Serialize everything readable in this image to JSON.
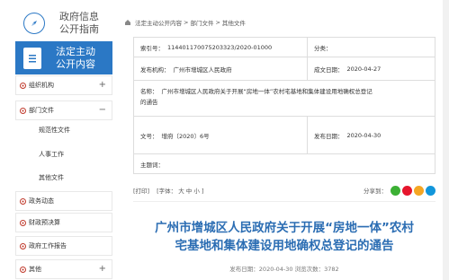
{
  "sidebar": {
    "guide_label_1": "政府信息",
    "guide_label_2": "公开指南",
    "active_label_1": "法定主动",
    "active_label_2": "公开内容",
    "items": [
      {
        "label": "组织机构",
        "toggle": "+"
      },
      {
        "label": "部门文件",
        "toggle": "−"
      },
      {
        "label": "规范性文件"
      },
      {
        "label": "人事工作"
      },
      {
        "label": "其他文件"
      },
      {
        "label": "政务动态"
      },
      {
        "label": "财政预决算"
      },
      {
        "label": "政府工作报告"
      },
      {
        "label": "其他",
        "toggle": "+"
      }
    ]
  },
  "breadcrumb": [
    "法定主动公开内容",
    "部门文件",
    "其他文件"
  ],
  "breadcrumb_sep": ">",
  "info": {
    "index_key": "索引号：",
    "index_val": "114401170075203323/2020-01000",
    "category_key": "分类：",
    "category_val": "",
    "issuer_key": "发布机构：",
    "issuer_val": "广州市增城区人民政府",
    "date_key": "成文日期：",
    "date_val": "2020-04-27",
    "name_key": "名称：",
    "name_val_1": "广州市增城区人民政府关于开展“房地一体”农村宅基地和集体建设用地确权总登记",
    "name_val_2": "的通告",
    "doc_key": "文号：",
    "doc_val": "增府〔2020〕6号",
    "pub_key": "发布日期：",
    "pub_val": "2020-04-30",
    "subject_key": "主题词：",
    "subject_val": ""
  },
  "tools": {
    "print": "[打印]",
    "font": "[字体：",
    "big": "大",
    "mid": "中",
    "small": "小",
    "font_end": "]",
    "share": "分享到："
  },
  "article": {
    "title_1": "广州市增城区人民政府关于开展“房地一体”农村",
    "title_2": "宅基地和集体建设用地确权总登记的通告",
    "meta": "发布日期：2020-04-30   浏览次数：3782"
  },
  "colors": {
    "accent": "#2b78c5",
    "title": "#2b6db3",
    "wechat": "#3cb034",
    "weibo": "#e6162d",
    "qzone": "#f5a623",
    "qq": "#1296db"
  }
}
